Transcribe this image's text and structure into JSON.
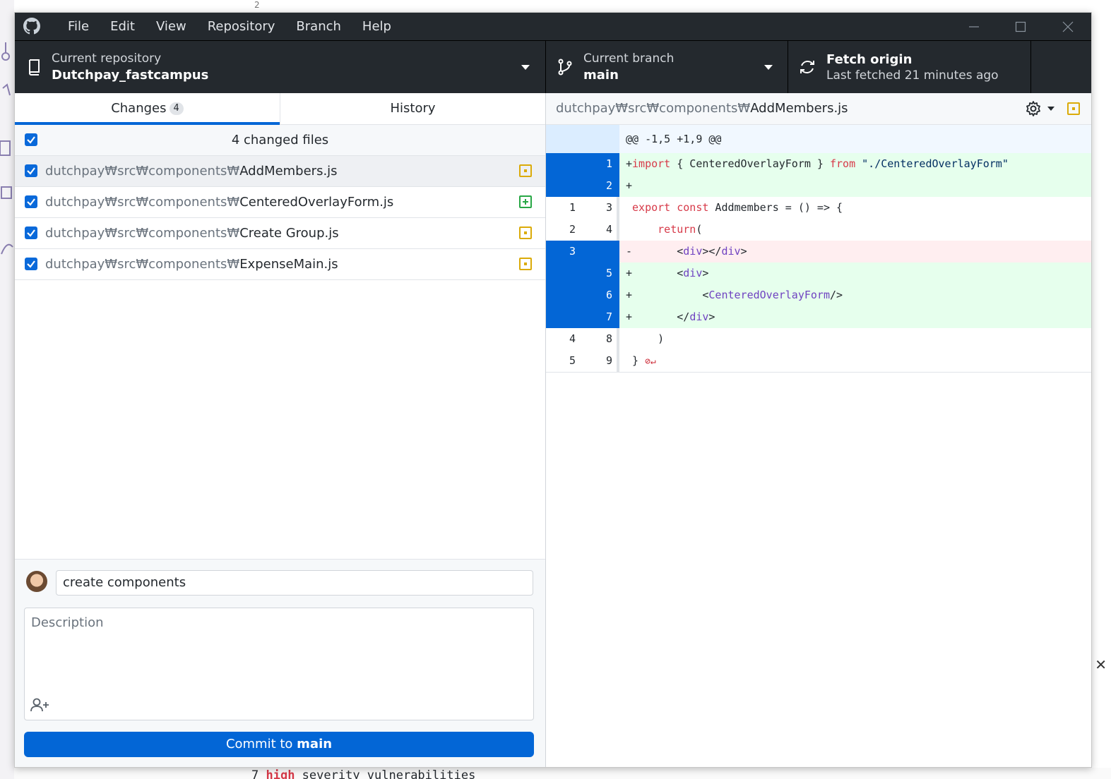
{
  "window": {
    "menu": [
      "File",
      "Edit",
      "View",
      "Repository",
      "Branch",
      "Help"
    ]
  },
  "toolbar": {
    "repo_label": "Current repository",
    "repo_value": "Dutchpay_fastcampus",
    "branch_label": "Current branch",
    "branch_value": "main",
    "fetch_title": "Fetch origin",
    "fetch_sub": "Last fetched 21 minutes ago"
  },
  "tabs": {
    "changes_label": "Changes",
    "changes_count": "4",
    "history_label": "History"
  },
  "files_header": "4 changed files",
  "files": [
    {
      "dir": "dutchpay₩src₩components₩",
      "name": "AddMembers.js",
      "status": "modified"
    },
    {
      "dir": "dutchpay₩src₩components₩",
      "name": "CenteredOverlayForm.js",
      "status": "added"
    },
    {
      "dir": "dutchpay₩src₩components₩",
      "name": "Create Group.js",
      "status": "modified"
    },
    {
      "dir": "dutchpay₩src₩components₩",
      "name": "ExpenseMain.js",
      "status": "modified"
    }
  ],
  "commit": {
    "summary_value": "create components",
    "description_placeholder": "Description",
    "button_prefix": "Commit to ",
    "button_branch": "main"
  },
  "diff": {
    "path_dir": "dutchpay₩src₩components₩",
    "path_file": "AddMembers.js",
    "hunk": "@@ -1,5 +1,9 @@",
    "lines": [
      {
        "type": "add",
        "old": "",
        "new": "1"
      },
      {
        "type": "add",
        "old": "",
        "new": "2"
      },
      {
        "type": "ctx",
        "old": "1",
        "new": "3"
      },
      {
        "type": "ctx",
        "old": "2",
        "new": "4"
      },
      {
        "type": "del",
        "old": "3",
        "new": ""
      },
      {
        "type": "add",
        "old": "",
        "new": "5"
      },
      {
        "type": "add",
        "old": "",
        "new": "6"
      },
      {
        "type": "add",
        "old": "",
        "new": "7"
      },
      {
        "type": "ctx",
        "old": "4",
        "new": "8"
      },
      {
        "type": "ctx",
        "old": "5",
        "new": "9"
      }
    ],
    "code": {
      "l1_plus": "+",
      "l1_import": "import",
      "l1_mid": " { CenteredOverlayForm } ",
      "l1_from": "from",
      "l1_str": " \"./CenteredOverlayForm\"",
      "l2": "+",
      "l3_export": "export",
      "l3_const": " const",
      "l3_rest": " Addmembers = () => {",
      "l4_return": "return",
      "l4_rest": "(",
      "l5_sign": "-",
      "l5_open": "<",
      "l5_tag1": "div",
      "l5_mid": "></",
      "l5_tag2": "div",
      "l5_close": ">",
      "l6_sign": "+",
      "l6_open": "<",
      "l6_tag": "div",
      "l6_close": ">",
      "l7_sign": "+",
      "l7_open": "<",
      "l7_tag": "CenteredOverlayForm",
      "l7_close": "/>",
      "l8_sign": "+",
      "l8_open": "</",
      "l8_tag": "div",
      "l8_close": ">",
      "l9": ")",
      "l10": "}"
    }
  },
  "background": {
    "bottom_prefix": "7 ",
    "bottom_red": "high",
    "bottom_rest": " severity vulnerabilities",
    "top_text": "2"
  },
  "colors": {
    "accent": "#0366d6",
    "titlebar": "#24292e",
    "added": "#28a745",
    "modified": "#dbab09",
    "add_bg": "#e6ffed",
    "del_bg": "#ffeef0"
  }
}
